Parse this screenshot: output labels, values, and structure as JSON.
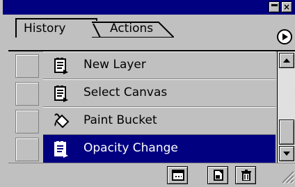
{
  "window": {
    "title": "",
    "close_glyph": "×"
  },
  "tabs": [
    {
      "label": "History",
      "active": true
    },
    {
      "label": "Actions",
      "active": false
    }
  ],
  "history_states": [
    {
      "label": "New Layer",
      "icon": "document-icon",
      "selected": false
    },
    {
      "label": "Select Canvas",
      "icon": "document-icon",
      "selected": false
    },
    {
      "label": "Paint Bucket",
      "icon": "paint-bucket-icon",
      "selected": false
    },
    {
      "label": "Opacity Change",
      "icon": "document-icon",
      "selected": true
    }
  ],
  "toolbar": {
    "buttons": [
      {
        "name": "new-document-from-state-button",
        "icon": "new-document-icon"
      },
      {
        "name": "create-snapshot-button",
        "icon": "snapshot-icon"
      },
      {
        "name": "delete-state-button",
        "icon": "trash-icon"
      }
    ]
  },
  "colors": {
    "title_bar": "#000080",
    "selection": "#000080",
    "panel": "#c0c0c0"
  }
}
